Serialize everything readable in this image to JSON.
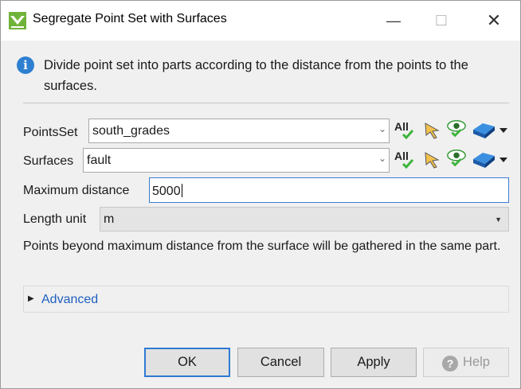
{
  "window": {
    "title": "Segregate Point Set with Surfaces",
    "controls": {
      "minimize": "—",
      "maximize": "☐",
      "close": "✕"
    }
  },
  "info": {
    "icon": "info-icon",
    "glyph": "i",
    "text": "Divide point set into parts according to the distance from the points to the surfaces."
  },
  "form": {
    "pointsset": {
      "label": "PointsSet",
      "value": "south_grades"
    },
    "surfaces": {
      "label": "Surfaces",
      "value": "fault"
    },
    "tool_all": "All",
    "max_distance": {
      "label": "Maximum distance",
      "value": "5000"
    },
    "length_unit": {
      "label": "Length unit",
      "value": "m"
    }
  },
  "note": "Points beyond maximum distance from the surface will be gathered in the same part.",
  "advanced": {
    "label": "Advanced"
  },
  "buttons": {
    "ok": "OK",
    "cancel": "Cancel",
    "apply": "Apply",
    "help": "Help",
    "help_glyph": "?"
  },
  "colors": {
    "accent": "#2f7ad4",
    "info": "#2f7fd1",
    "link": "#1f5fbf",
    "check": "#3cb43c",
    "app_icon": "#6fb33a"
  }
}
